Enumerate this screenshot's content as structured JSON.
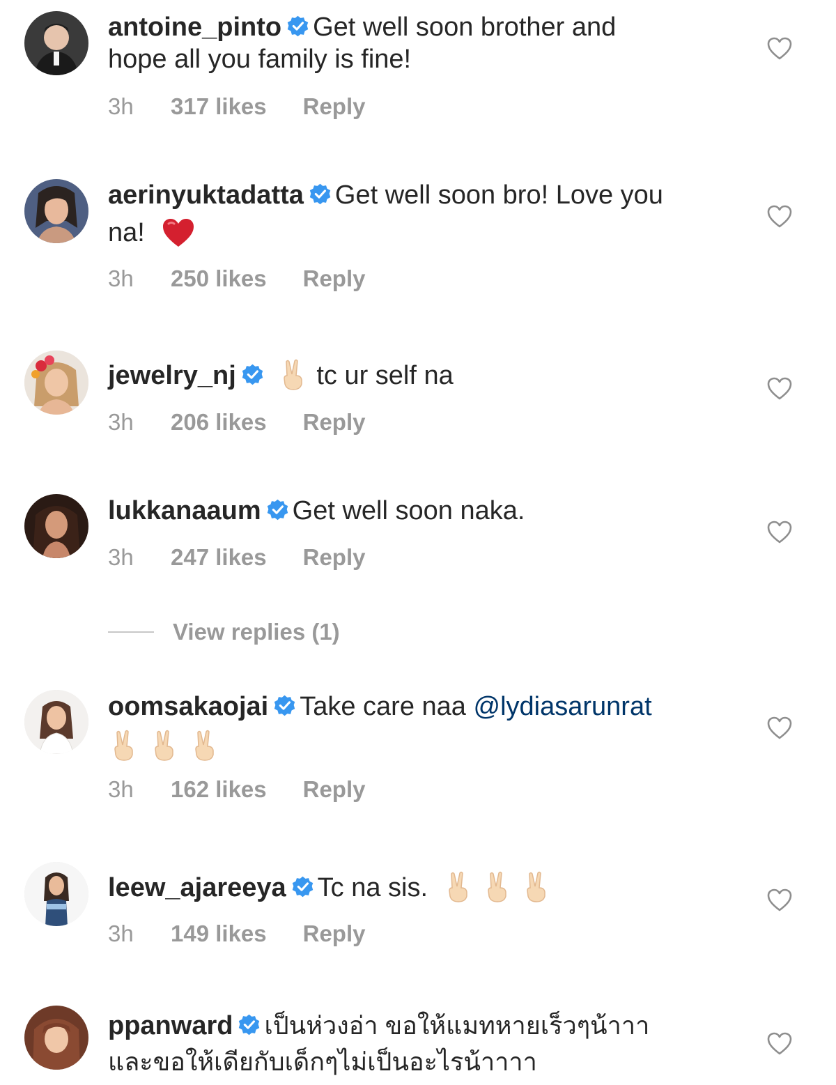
{
  "comments": [
    {
      "username": "antoine_pinto",
      "text_line1": "Get well soon brother and",
      "text_line2": "hope all you family is fine!",
      "time": "3h",
      "likes": "317 likes",
      "reply": "Reply",
      "avatar_colors": [
        "#3a3a3a",
        "#f2d4bf"
      ]
    },
    {
      "username": "aerinyuktadatta",
      "text_line1": "Get well soon bro! Love you",
      "text_line2": "na!",
      "emoji": "red-heart",
      "time": "3h",
      "likes": "250 likes",
      "reply": "Reply",
      "avatar_colors": [
        "#5a6b8c",
        "#e8b99c"
      ]
    },
    {
      "username": "jewelry_nj",
      "text_line1": "tc ur self na",
      "emoji": "victory-hand",
      "time": "3h",
      "likes": "206 likes",
      "reply": "Reply",
      "avatar_colors": [
        "#e9e0d6",
        "#d9a77f"
      ]
    },
    {
      "username": "lukkanaaum",
      "text_line1": "Get well soon naka.",
      "time": "3h",
      "likes": "247 likes",
      "reply": "Reply",
      "avatar_colors": [
        "#2a1a14",
        "#d49a7a"
      ]
    },
    {
      "username": "oomsakaojai",
      "text_line1": "Take care naa",
      "mention": "@lydiasarunrat",
      "emoji": "victory-hand x3",
      "time": "3h",
      "likes": "162 likes",
      "reply": "Reply",
      "avatar_colors": [
        "#f3f1ef",
        "#5b3a2c"
      ]
    },
    {
      "username": "leew_ajareeya",
      "text_line1": "Tc na sis.",
      "emoji": "victory-hand x3",
      "time": "3h",
      "likes": "149 likes",
      "reply": "Reply",
      "avatar_colors": [
        "#f4f4f4",
        "#2f4f7a"
      ]
    },
    {
      "username": "ppanward",
      "text_line1": "เป็นห่วงอ่า ขอให้แมทหายเร็วๆน้าาา",
      "text_line2": "และขอให้เดียกับเด็กๆไม่เป็นอะไรน้าาาา",
      "avatar_colors": [
        "#8a4a32",
        "#f0c7a8"
      ]
    }
  ],
  "view_replies": "View replies (1)",
  "colors": {
    "text": "#262626",
    "meta": "#999999",
    "verified": "#3897f0",
    "mention": "#003569"
  },
  "icons": [
    "verified-badge-icon",
    "heart-icon"
  ]
}
